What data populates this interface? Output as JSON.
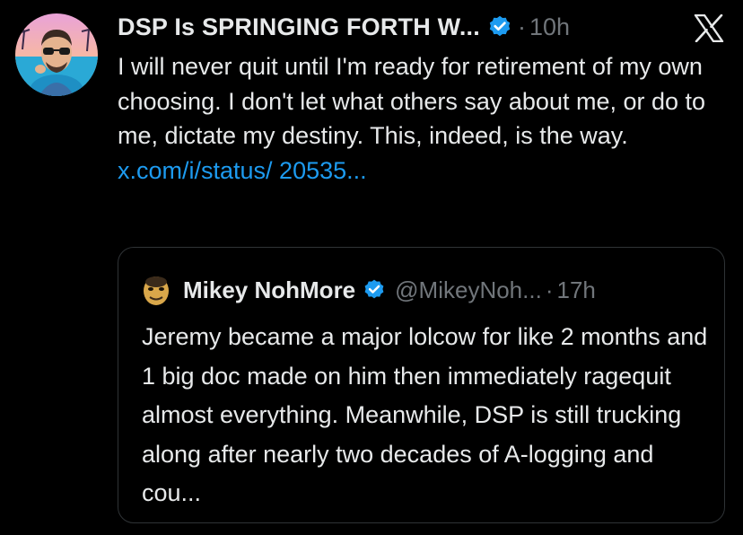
{
  "tweet": {
    "author_name": "DSP Is SPRINGING FORTH W...",
    "separator": "·",
    "time": "10h",
    "text_plain": "I will never quit until I'm ready for retirement of my own choosing. I don't let what others say about me, or do to me, dictate my destiny. This, indeed, is the way. ",
    "link_text": "x.com/i/status/ 20535...",
    "verified_icon": "verified-badge-icon",
    "accent_color": "#1d9bf0"
  },
  "quoted_tweet": {
    "author_name": "Mikey NohMore",
    "handle": "@MikeyNoh...",
    "separator": "·",
    "time": "17h",
    "text": "Jeremy became a major lolcow for like 2 months and 1 big doc made on him then immediately ragequit almost everything. Meanwhile, DSP is still trucking along after nearly two decades of A-logging and cou..."
  },
  "app": {
    "logo": "x-logo-icon"
  }
}
